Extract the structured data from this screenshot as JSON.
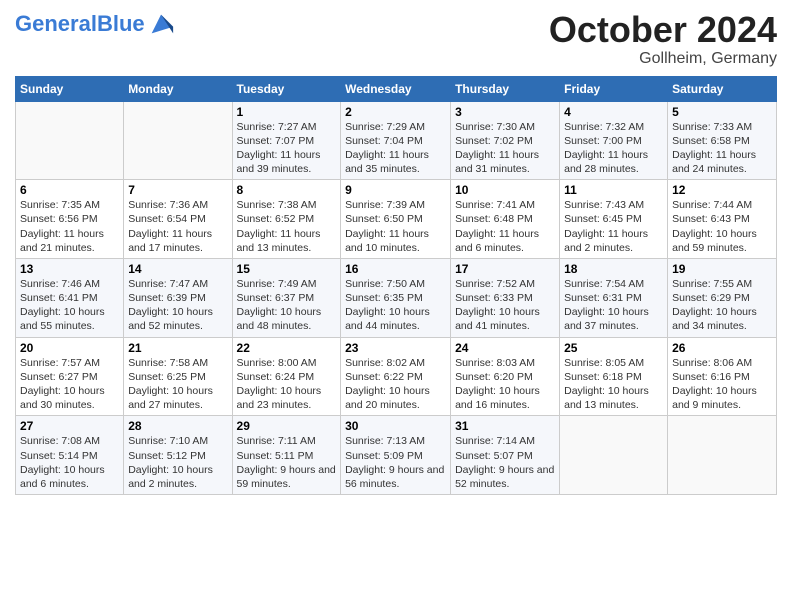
{
  "header": {
    "logo_general": "General",
    "logo_blue": "Blue",
    "month_title": "October 2024",
    "location": "Gollheim, Germany"
  },
  "days_of_week": [
    "Sunday",
    "Monday",
    "Tuesday",
    "Wednesday",
    "Thursday",
    "Friday",
    "Saturday"
  ],
  "weeks": [
    [
      {
        "num": "",
        "detail": ""
      },
      {
        "num": "",
        "detail": ""
      },
      {
        "num": "1",
        "detail": "Sunrise: 7:27 AM\nSunset: 7:07 PM\nDaylight: 11 hours and 39 minutes."
      },
      {
        "num": "2",
        "detail": "Sunrise: 7:29 AM\nSunset: 7:04 PM\nDaylight: 11 hours and 35 minutes."
      },
      {
        "num": "3",
        "detail": "Sunrise: 7:30 AM\nSunset: 7:02 PM\nDaylight: 11 hours and 31 minutes."
      },
      {
        "num": "4",
        "detail": "Sunrise: 7:32 AM\nSunset: 7:00 PM\nDaylight: 11 hours and 28 minutes."
      },
      {
        "num": "5",
        "detail": "Sunrise: 7:33 AM\nSunset: 6:58 PM\nDaylight: 11 hours and 24 minutes."
      }
    ],
    [
      {
        "num": "6",
        "detail": "Sunrise: 7:35 AM\nSunset: 6:56 PM\nDaylight: 11 hours and 21 minutes."
      },
      {
        "num": "7",
        "detail": "Sunrise: 7:36 AM\nSunset: 6:54 PM\nDaylight: 11 hours and 17 minutes."
      },
      {
        "num": "8",
        "detail": "Sunrise: 7:38 AM\nSunset: 6:52 PM\nDaylight: 11 hours and 13 minutes."
      },
      {
        "num": "9",
        "detail": "Sunrise: 7:39 AM\nSunset: 6:50 PM\nDaylight: 11 hours and 10 minutes."
      },
      {
        "num": "10",
        "detail": "Sunrise: 7:41 AM\nSunset: 6:48 PM\nDaylight: 11 hours and 6 minutes."
      },
      {
        "num": "11",
        "detail": "Sunrise: 7:43 AM\nSunset: 6:45 PM\nDaylight: 11 hours and 2 minutes."
      },
      {
        "num": "12",
        "detail": "Sunrise: 7:44 AM\nSunset: 6:43 PM\nDaylight: 10 hours and 59 minutes."
      }
    ],
    [
      {
        "num": "13",
        "detail": "Sunrise: 7:46 AM\nSunset: 6:41 PM\nDaylight: 10 hours and 55 minutes."
      },
      {
        "num": "14",
        "detail": "Sunrise: 7:47 AM\nSunset: 6:39 PM\nDaylight: 10 hours and 52 minutes."
      },
      {
        "num": "15",
        "detail": "Sunrise: 7:49 AM\nSunset: 6:37 PM\nDaylight: 10 hours and 48 minutes."
      },
      {
        "num": "16",
        "detail": "Sunrise: 7:50 AM\nSunset: 6:35 PM\nDaylight: 10 hours and 44 minutes."
      },
      {
        "num": "17",
        "detail": "Sunrise: 7:52 AM\nSunset: 6:33 PM\nDaylight: 10 hours and 41 minutes."
      },
      {
        "num": "18",
        "detail": "Sunrise: 7:54 AM\nSunset: 6:31 PM\nDaylight: 10 hours and 37 minutes."
      },
      {
        "num": "19",
        "detail": "Sunrise: 7:55 AM\nSunset: 6:29 PM\nDaylight: 10 hours and 34 minutes."
      }
    ],
    [
      {
        "num": "20",
        "detail": "Sunrise: 7:57 AM\nSunset: 6:27 PM\nDaylight: 10 hours and 30 minutes."
      },
      {
        "num": "21",
        "detail": "Sunrise: 7:58 AM\nSunset: 6:25 PM\nDaylight: 10 hours and 27 minutes."
      },
      {
        "num": "22",
        "detail": "Sunrise: 8:00 AM\nSunset: 6:24 PM\nDaylight: 10 hours and 23 minutes."
      },
      {
        "num": "23",
        "detail": "Sunrise: 8:02 AM\nSunset: 6:22 PM\nDaylight: 10 hours and 20 minutes."
      },
      {
        "num": "24",
        "detail": "Sunrise: 8:03 AM\nSunset: 6:20 PM\nDaylight: 10 hours and 16 minutes."
      },
      {
        "num": "25",
        "detail": "Sunrise: 8:05 AM\nSunset: 6:18 PM\nDaylight: 10 hours and 13 minutes."
      },
      {
        "num": "26",
        "detail": "Sunrise: 8:06 AM\nSunset: 6:16 PM\nDaylight: 10 hours and 9 minutes."
      }
    ],
    [
      {
        "num": "27",
        "detail": "Sunrise: 7:08 AM\nSunset: 5:14 PM\nDaylight: 10 hours and 6 minutes."
      },
      {
        "num": "28",
        "detail": "Sunrise: 7:10 AM\nSunset: 5:12 PM\nDaylight: 10 hours and 2 minutes."
      },
      {
        "num": "29",
        "detail": "Sunrise: 7:11 AM\nSunset: 5:11 PM\nDaylight: 9 hours and 59 minutes."
      },
      {
        "num": "30",
        "detail": "Sunrise: 7:13 AM\nSunset: 5:09 PM\nDaylight: 9 hours and 56 minutes."
      },
      {
        "num": "31",
        "detail": "Sunrise: 7:14 AM\nSunset: 5:07 PM\nDaylight: 9 hours and 52 minutes."
      },
      {
        "num": "",
        "detail": ""
      },
      {
        "num": "",
        "detail": ""
      }
    ]
  ]
}
